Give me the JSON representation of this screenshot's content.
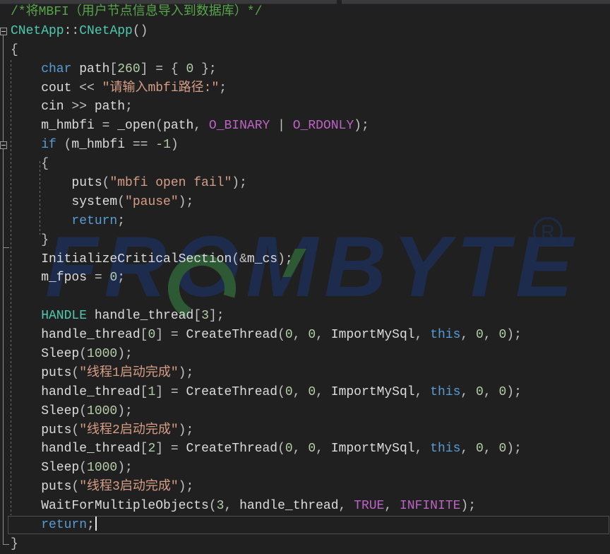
{
  "palette": {
    "background": "#202020",
    "top_strip": "#3a3a3c",
    "comment_green": "#57A64A",
    "keyword_blue": "#569CD6",
    "type_teal": "#4EC9B0",
    "string_salmon": "#D69D85",
    "number_green": "#B5CEA8",
    "macro_purple": "#BD63C5",
    "identifier_gray": "#DCDCDC",
    "operator_gray": "#C0C0C0",
    "indent_guide": "#6E6E6E",
    "outline_line": "#8F8F8F",
    "current_line_border": "#4F4F4F",
    "watermark_navy": "#1D2C4C",
    "watermark_green": "#2D5A35"
  },
  "watermark": {
    "text": "FROMBYTE",
    "registered_symbol": "R"
  },
  "editor": {
    "current_line_index": 27,
    "fold_marker_lines": [
      1,
      7
    ],
    "lines": [
      {
        "tokens": [
          [
            "comment",
            "/*将MBFI（用户节点信息导入到数据库）*/"
          ]
        ]
      },
      {
        "tokens": [
          [
            "type",
            "CNetApp"
          ],
          [
            "op",
            "::"
          ],
          [
            "type",
            "CNetApp"
          ],
          [
            "op",
            "()"
          ]
        ]
      },
      {
        "tokens": [
          [
            "op",
            "{"
          ]
        ]
      },
      {
        "tokens": [
          [
            "kw",
            "    char"
          ],
          [
            "id",
            " path"
          ],
          [
            "op",
            "["
          ],
          [
            "num",
            "260"
          ],
          [
            "op",
            "] = { "
          ],
          [
            "num",
            "0"
          ],
          [
            "op",
            " };"
          ]
        ]
      },
      {
        "tokens": [
          [
            "id",
            "    cout"
          ],
          [
            "op",
            " << "
          ],
          [
            "str",
            "\"请输入mbfi路径:\""
          ],
          [
            "op",
            ";"
          ]
        ]
      },
      {
        "tokens": [
          [
            "id",
            "    cin"
          ],
          [
            "op",
            " >> "
          ],
          [
            "id",
            "path"
          ],
          [
            "op",
            ";"
          ]
        ]
      },
      {
        "tokens": [
          [
            "id",
            "    m_hmbfi"
          ],
          [
            "op",
            " = "
          ],
          [
            "id",
            "_open"
          ],
          [
            "op",
            "("
          ],
          [
            "id",
            "path"
          ],
          [
            "op",
            ", "
          ],
          [
            "macro",
            "O_BINARY"
          ],
          [
            "op",
            " | "
          ],
          [
            "macro",
            "O_RDONLY"
          ],
          [
            "op",
            ");"
          ]
        ]
      },
      {
        "tokens": [
          [
            "kw",
            "    if"
          ],
          [
            "op",
            " ("
          ],
          [
            "id",
            "m_hmbfi"
          ],
          [
            "op",
            " == "
          ],
          [
            "num",
            "-1"
          ],
          [
            "op",
            ")"
          ]
        ]
      },
      {
        "tokens": [
          [
            "op",
            "    {"
          ]
        ]
      },
      {
        "tokens": [
          [
            "id",
            "        puts"
          ],
          [
            "op",
            "("
          ],
          [
            "str",
            "\"mbfi open fail\""
          ],
          [
            "op",
            ");"
          ]
        ]
      },
      {
        "tokens": [
          [
            "id",
            "        system"
          ],
          [
            "op",
            "("
          ],
          [
            "str",
            "\"pause\""
          ],
          [
            "op",
            ");"
          ]
        ]
      },
      {
        "tokens": [
          [
            "kw",
            "        return"
          ],
          [
            "op",
            ";"
          ]
        ]
      },
      {
        "tokens": [
          [
            "op",
            "    }"
          ]
        ]
      },
      {
        "tokens": [
          [
            "id",
            "    InitializeCriticalSection"
          ],
          [
            "op",
            "(&"
          ],
          [
            "id",
            "m_cs"
          ],
          [
            "op",
            ");"
          ]
        ]
      },
      {
        "tokens": [
          [
            "id",
            "    m_fpos"
          ],
          [
            "op",
            " = "
          ],
          [
            "num",
            "0"
          ],
          [
            "op",
            ";"
          ]
        ]
      },
      {
        "tokens": []
      },
      {
        "tokens": [
          [
            "type",
            "    HANDLE"
          ],
          [
            "id",
            " handle_thread"
          ],
          [
            "op",
            "["
          ],
          [
            "num",
            "3"
          ],
          [
            "op",
            "];"
          ]
        ]
      },
      {
        "tokens": [
          [
            "id",
            "    handle_thread"
          ],
          [
            "op",
            "["
          ],
          [
            "num",
            "0"
          ],
          [
            "op",
            "] = "
          ],
          [
            "id",
            "CreateThread"
          ],
          [
            "op",
            "("
          ],
          [
            "num",
            "0"
          ],
          [
            "op",
            ", "
          ],
          [
            "num",
            "0"
          ],
          [
            "op",
            ", "
          ],
          [
            "id",
            "ImportMySql"
          ],
          [
            "op",
            ", "
          ],
          [
            "kw",
            "this"
          ],
          [
            "op",
            ", "
          ],
          [
            "num",
            "0"
          ],
          [
            "op",
            ", "
          ],
          [
            "num",
            "0"
          ],
          [
            "op",
            ");"
          ]
        ]
      },
      {
        "tokens": [
          [
            "id",
            "    Sleep"
          ],
          [
            "op",
            "("
          ],
          [
            "num",
            "1000"
          ],
          [
            "op",
            ");"
          ]
        ]
      },
      {
        "tokens": [
          [
            "id",
            "    puts"
          ],
          [
            "op",
            "("
          ],
          [
            "str",
            "\"线程1启动完成\""
          ],
          [
            "op",
            ");"
          ]
        ]
      },
      {
        "tokens": [
          [
            "id",
            "    handle_thread"
          ],
          [
            "op",
            "["
          ],
          [
            "num",
            "1"
          ],
          [
            "op",
            "] = "
          ],
          [
            "id",
            "CreateThread"
          ],
          [
            "op",
            "("
          ],
          [
            "num",
            "0"
          ],
          [
            "op",
            ", "
          ],
          [
            "num",
            "0"
          ],
          [
            "op",
            ", "
          ],
          [
            "id",
            "ImportMySql"
          ],
          [
            "op",
            ", "
          ],
          [
            "kw",
            "this"
          ],
          [
            "op",
            ", "
          ],
          [
            "num",
            "0"
          ],
          [
            "op",
            ", "
          ],
          [
            "num",
            "0"
          ],
          [
            "op",
            ");"
          ]
        ]
      },
      {
        "tokens": [
          [
            "id",
            "    Sleep"
          ],
          [
            "op",
            "("
          ],
          [
            "num",
            "1000"
          ],
          [
            "op",
            ");"
          ]
        ]
      },
      {
        "tokens": [
          [
            "id",
            "    puts"
          ],
          [
            "op",
            "("
          ],
          [
            "str",
            "\"线程2启动完成\""
          ],
          [
            "op",
            ");"
          ]
        ]
      },
      {
        "tokens": [
          [
            "id",
            "    handle_thread"
          ],
          [
            "op",
            "["
          ],
          [
            "num",
            "2"
          ],
          [
            "op",
            "] = "
          ],
          [
            "id",
            "CreateThread"
          ],
          [
            "op",
            "("
          ],
          [
            "num",
            "0"
          ],
          [
            "op",
            ", "
          ],
          [
            "num",
            "0"
          ],
          [
            "op",
            ", "
          ],
          [
            "id",
            "ImportMySql"
          ],
          [
            "op",
            ", "
          ],
          [
            "kw",
            "this"
          ],
          [
            "op",
            ", "
          ],
          [
            "num",
            "0"
          ],
          [
            "op",
            ", "
          ],
          [
            "num",
            "0"
          ],
          [
            "op",
            ");"
          ]
        ]
      },
      {
        "tokens": [
          [
            "id",
            "    Sleep"
          ],
          [
            "op",
            "("
          ],
          [
            "num",
            "1000"
          ],
          [
            "op",
            ");"
          ]
        ]
      },
      {
        "tokens": [
          [
            "id",
            "    puts"
          ],
          [
            "op",
            "("
          ],
          [
            "str",
            "\"线程3启动完成\""
          ],
          [
            "op",
            ");"
          ]
        ]
      },
      {
        "tokens": [
          [
            "id",
            "    WaitForMultipleObjects"
          ],
          [
            "op",
            "("
          ],
          [
            "num",
            "3"
          ],
          [
            "op",
            ", "
          ],
          [
            "id",
            "handle_thread"
          ],
          [
            "op",
            ", "
          ],
          [
            "macro",
            "TRUE"
          ],
          [
            "op",
            ", "
          ],
          [
            "macro",
            "INFINITE"
          ],
          [
            "op",
            ");"
          ]
        ]
      },
      {
        "tokens": [
          [
            "kw",
            "    return"
          ],
          [
            "op",
            ";"
          ]
        ]
      },
      {
        "tokens": [
          [
            "op",
            "}"
          ]
        ]
      }
    ]
  }
}
